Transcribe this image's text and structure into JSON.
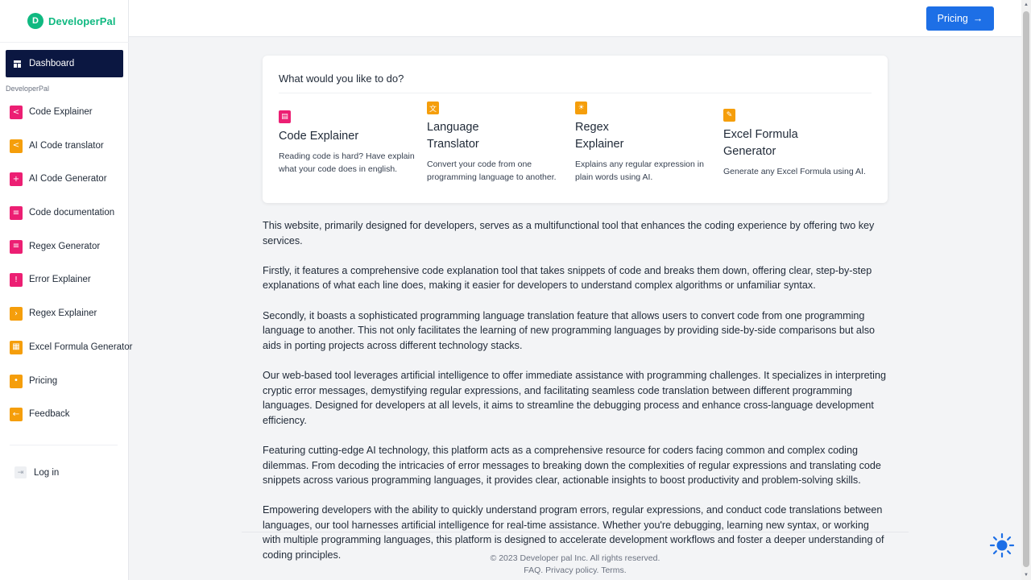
{
  "brand": {
    "name": "DeveloperPal",
    "logo_glyph": "D"
  },
  "sidebar": {
    "dashboard_label": "Dashboard",
    "section_label": "DeveloperPal",
    "items": [
      {
        "label": "Code Explainer",
        "icon": "code-brackets-icon",
        "glyph": "<",
        "color": "#ec1f73"
      },
      {
        "label": "AI Code translator",
        "icon": "code-brackets-icon",
        "glyph": "<",
        "color": "#f59e0b"
      },
      {
        "label": "AI Code Generator",
        "icon": "plus-icon",
        "glyph": "+",
        "color": "#ec1f73"
      },
      {
        "label": "Code documentation",
        "icon": "document-icon",
        "glyph": "≡",
        "color": "#ec1f73"
      },
      {
        "label": "Regex Generator",
        "icon": "regex-icon",
        "glyph": "≡",
        "color": "#ec1f73"
      },
      {
        "label": "Error Explainer",
        "icon": "alert-circle-icon",
        "glyph": "!",
        "color": "#ec1f73"
      },
      {
        "label": "Regex Explainer",
        "icon": "lightning-icon",
        "glyph": "›",
        "color": "#f59e0b"
      },
      {
        "label": "Excel Formula Generator",
        "icon": "table-icon",
        "glyph": "▦",
        "color": "#f59e0b"
      },
      {
        "label": "Pricing",
        "icon": "tag-icon",
        "glyph": "•",
        "color": "#f59e0b"
      },
      {
        "label": "Feedback",
        "icon": "arrow-left-icon",
        "glyph": "←",
        "color": "#f59e0b"
      }
    ],
    "login_label": "Log in"
  },
  "header": {
    "pricing_label": "Pricing",
    "pricing_arrow": "→",
    "accent": "#1d6fe6"
  },
  "card": {
    "title": "What would you like to do?",
    "tools": [
      {
        "name": "Code Explainer",
        "description": "Reading code is hard? Have explain what your code does in english.",
        "icon": "chat-icon",
        "glyph": "▤",
        "color": "#ec1f73"
      },
      {
        "name": "Language Translator",
        "description": "Convert your code from one programming language to another.",
        "icon": "translate-icon",
        "glyph": "文",
        "color": "#f59e0b"
      },
      {
        "name": "Regex Explainer",
        "description": "Explains any regular expression in plain words using AI.",
        "icon": "lightbulb-icon",
        "glyph": "☀",
        "color": "#f59e0b"
      },
      {
        "name": "Excel Formula Generator",
        "description": "Generate any Excel Formula using AI.",
        "icon": "pencil-icon",
        "glyph": "✎",
        "color": "#f59e0b"
      }
    ]
  },
  "content": {
    "paragraphs": [
      "This website, primarily designed for developers, serves as a multifunctional tool that enhances the coding experience by offering two key services.",
      "Firstly, it features a comprehensive code explanation tool that takes snippets of code and breaks them down, offering clear, step-by-step explanations of what each line does, making it easier for developers to understand complex algorithms or unfamiliar syntax.",
      "Secondly, it boasts a sophisticated programming language translation feature that allows users to convert code from one programming language to another. This not only facilitates the learning of new programming languages by providing side-by-side comparisons but also aids in porting projects across different technology stacks.",
      "Our web-based tool leverages artificial intelligence to offer immediate assistance with programming challenges. It specializes in interpreting cryptic error messages, demystifying regular expressions, and facilitating seamless code translation between different programming languages. Designed for developers at all levels, it aims to streamline the debugging process and enhance cross-language development efficiency.",
      "Featuring cutting-edge AI technology, this platform acts as a comprehensive resource for coders facing common and complex coding dilemmas. From decoding the intricacies of error messages to breaking down the complexities of regular expressions and translating code snippets across various programming languages, it provides clear, actionable insights to boost productivity and problem-solving skills.",
      "Empowering developers with the ability to quickly understand program errors, regular expressions, and conduct code translations between languages, our tool harnesses artificial intelligence for real-time assistance. Whether you're debugging, learning new syntax, or working with multiple programming languages, this platform is designed to accelerate development workflows and foster a deeper understanding of coding principles."
    ]
  },
  "footer": {
    "copyright": "© 2023 Developer pal Inc. All rights reserved.",
    "faq": "FAQ.",
    "privacy": "Privacy policy.",
    "terms": "Terms."
  },
  "theme_toggle": {
    "icon": "sun-icon",
    "color": "#1d6fe6"
  }
}
